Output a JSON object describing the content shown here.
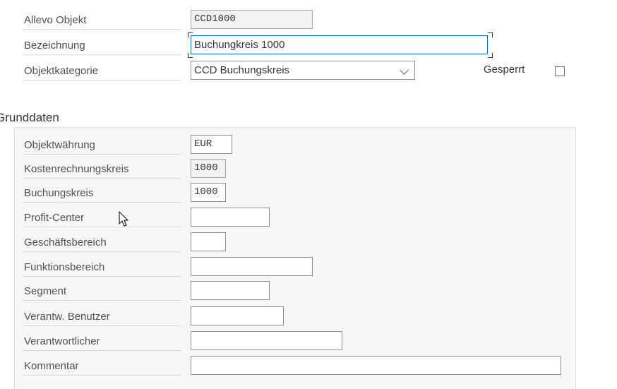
{
  "header": {
    "allevo_objekt": {
      "label": "Allevo Objekt",
      "value": "CCD1000"
    },
    "bezeichnung": {
      "label": "Bezeichnung",
      "value": "Buchungkreis 1000"
    },
    "objektkategorie": {
      "label": "Objektkategorie",
      "value": "CCD Buchungskreis"
    },
    "gesperrt": {
      "label": "Gesperrt",
      "checked": false
    }
  },
  "grunddaten": {
    "title": "Grunddaten",
    "fields": [
      {
        "label": "Objektwährung",
        "value": "EUR"
      },
      {
        "label": "Kostenrechnungskreis",
        "value": "1000"
      },
      {
        "label": "Buchungskreis",
        "value": "1000"
      },
      {
        "label": "Profit-Center",
        "value": ""
      },
      {
        "label": "Geschäftsbereich",
        "value": ""
      },
      {
        "label": "Funktionsbereich",
        "value": ""
      },
      {
        "label": "Segment",
        "value": ""
      },
      {
        "label": "Verantw. Benutzer",
        "value": ""
      },
      {
        "label": "Verantwortlicher",
        "value": ""
      },
      {
        "label": "Kommentar",
        "value": ""
      }
    ]
  },
  "icons": {
    "dropdown": "chevron-down-icon",
    "cursor": "mouse-pointer-icon"
  },
  "colors": {
    "focus": "#0a6ed1",
    "group_bg": "#f7f7f7",
    "readonly_bg": "#f2f2f2"
  }
}
